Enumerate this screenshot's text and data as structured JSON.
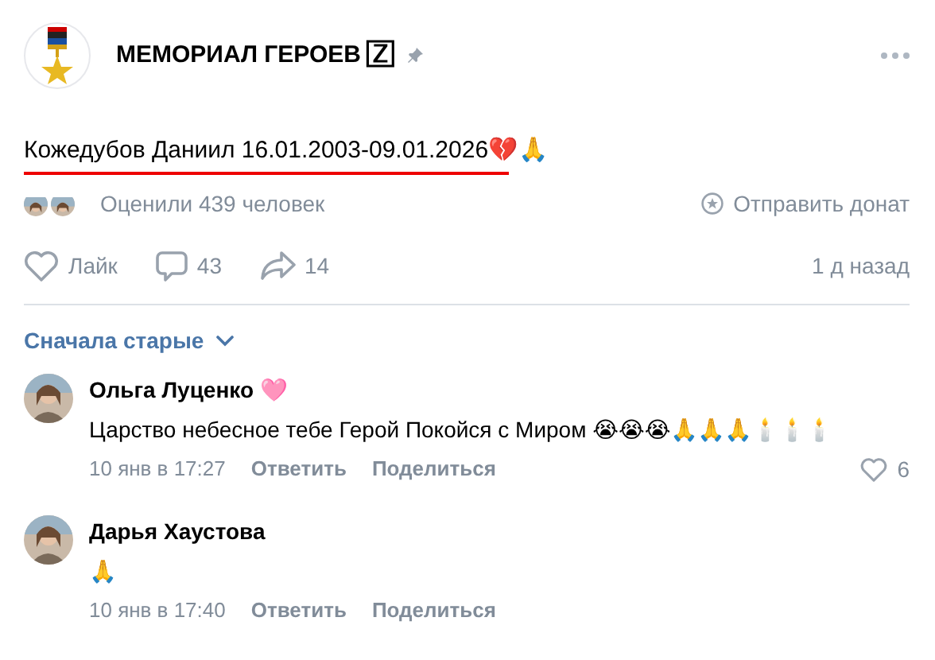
{
  "post": {
    "author": "МЕМОРИАЛ ГЕРОЕВ 🅉",
    "text": "Кожедубов Даниил 16.01.2003-09.01.2026💔🙏",
    "rated": "Оценили 439 человек",
    "donate": "Отправить донат",
    "like_label": "Лайк",
    "comments": "43",
    "shares": "14",
    "time": "1 д назад"
  },
  "sort": "Сначала старые",
  "comments": [
    {
      "name": "Ольга Луценко",
      "badge": "🩷",
      "text": "Царство небесное тебе Герой Покойся с Миром 😭😭😭🙏🙏🙏🕯️🕯️🕯️",
      "time": "10 янв в 17:27",
      "reply": "Ответить",
      "share": "Поделиться",
      "likes": "6"
    },
    {
      "name": "Дарья Хаустова",
      "text": "🙏",
      "time": "10 янв в 17:40",
      "reply": "Ответить",
      "share": "Поделиться"
    }
  ]
}
